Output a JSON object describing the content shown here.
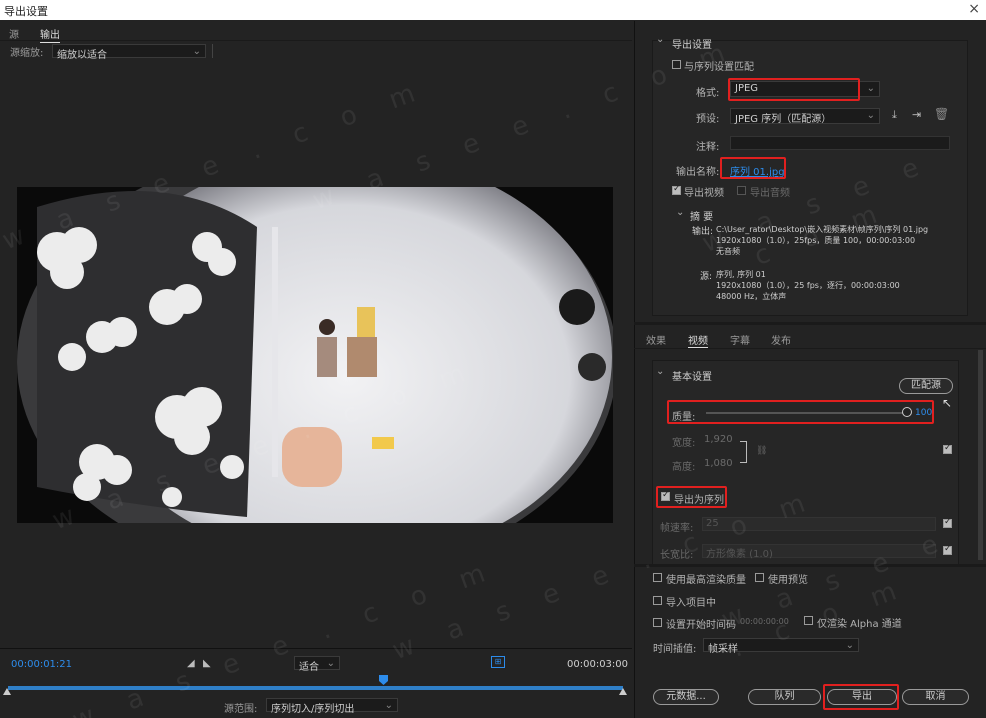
{
  "window": {
    "title": "导出设置",
    "close": "×"
  },
  "left": {
    "tabs": [
      "源",
      "输出"
    ],
    "source_scale_label": "源缩放:",
    "source_scale_value": "缩放以适合",
    "current_time": "00:00:01:21",
    "fit_value": "适合",
    "end_time": "00:00:03:00",
    "source_range_label": "源范围:",
    "source_range_value": "序列切入/序列切出"
  },
  "export_settings": {
    "header": "导出设置",
    "match_sequence": "与序列设置匹配",
    "format_label": "格式:",
    "format_value": "JPEG",
    "preset_label": "预设:",
    "preset_value": "JPEG 序列（匹配源）",
    "comments_label": "注释:",
    "output_name_label": "输出名称:",
    "output_name_value": "序列 01.jpg",
    "export_video": "导出视频",
    "export_audio": "导出音频",
    "summary_header": "摘 要",
    "summary_output_label": "输出:",
    "summary_output_lines": [
      "C:\\User_rator\\Desktop\\嵌入视频素材\\帧序列\\序列 01.jpg",
      "1920x1080（1.0），25fps，质量 100，00:00:03:00",
      "无音频"
    ],
    "summary_source_label": "源:",
    "summary_source_lines": [
      "序列, 序列 01",
      "1920x1080（1.0），25 fps，逐行，00:00:03:00",
      "48000 Hz，立体声"
    ]
  },
  "sub_tabs": [
    "效果",
    "视频",
    "字幕",
    "发布"
  ],
  "basic_settings": {
    "header": "基本设置",
    "match_source_button": "匹配源",
    "quality_label": "质量:",
    "quality_value": "100",
    "width_label": "宽度:",
    "width_value": "1,920",
    "height_label": "高度:",
    "height_value": "1,080",
    "export_as_sequence": "导出为序列",
    "frame_rate_label": "帧速率:",
    "frame_rate_value": "25",
    "aspect_label": "长宽比:",
    "aspect_value": "方形像素 (1.0)"
  },
  "bottom": {
    "max_render": "使用最高渲染质量",
    "use_previews": "使用预览",
    "import_project": "导入项目中",
    "set_start_tc": "设置开始时间码",
    "start_tc_value": "00:00:00:00",
    "render_alpha": "仅渲染 Alpha 通道",
    "time_interp_label": "时间插值:",
    "time_interp_value": "帧采样",
    "metadata_button": "元数据...",
    "queue_button": "队列",
    "export_button": "导出",
    "cancel_button": "取消"
  },
  "watermark": "w a s e e . c o m",
  "colors": {
    "accent_blue": "#2d8ceb",
    "highlight_red": "#e1201f"
  }
}
